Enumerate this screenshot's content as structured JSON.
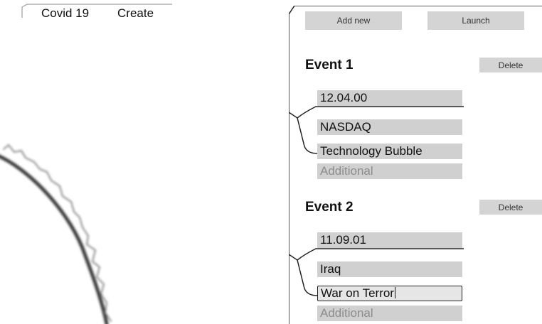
{
  "tabs": [
    {
      "label": "Covid 19"
    },
    {
      "label": "Create"
    }
  ],
  "toolbar": {
    "add_new_label": "Add new",
    "launch_label": "Launch"
  },
  "events": [
    {
      "title": "Event 1",
      "delete_label": "Delete",
      "fields": [
        {
          "value": "12.04.00"
        },
        {
          "value": "NASDAQ"
        },
        {
          "value": "Technology Bubble"
        },
        {
          "placeholder": "Additional"
        }
      ]
    },
    {
      "title": "Event 2",
      "delete_label": "Delete",
      "fields": [
        {
          "value": "11.09.01"
        },
        {
          "value": "Iraq"
        },
        {
          "value": "War on Terror",
          "focused": true
        },
        {
          "placeholder": "Additional"
        }
      ]
    }
  ]
}
